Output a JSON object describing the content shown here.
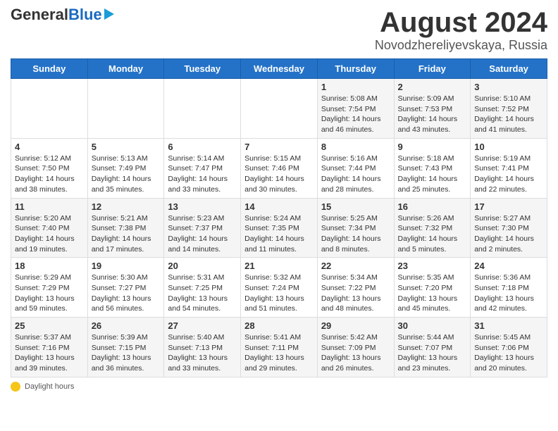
{
  "header": {
    "logo_general": "General",
    "logo_blue": "Blue",
    "month_title": "August 2024",
    "location": "Novodzhereliyevskaya, Russia"
  },
  "days_of_week": [
    "Sunday",
    "Monday",
    "Tuesday",
    "Wednesday",
    "Thursday",
    "Friday",
    "Saturday"
  ],
  "weeks": [
    [
      {
        "day": "",
        "info": ""
      },
      {
        "day": "",
        "info": ""
      },
      {
        "day": "",
        "info": ""
      },
      {
        "day": "",
        "info": ""
      },
      {
        "day": "1",
        "info": "Sunrise: 5:08 AM\nSunset: 7:54 PM\nDaylight: 14 hours and 46 minutes."
      },
      {
        "day": "2",
        "info": "Sunrise: 5:09 AM\nSunset: 7:53 PM\nDaylight: 14 hours and 43 minutes."
      },
      {
        "day": "3",
        "info": "Sunrise: 5:10 AM\nSunset: 7:52 PM\nDaylight: 14 hours and 41 minutes."
      }
    ],
    [
      {
        "day": "4",
        "info": "Sunrise: 5:12 AM\nSunset: 7:50 PM\nDaylight: 14 hours and 38 minutes."
      },
      {
        "day": "5",
        "info": "Sunrise: 5:13 AM\nSunset: 7:49 PM\nDaylight: 14 hours and 35 minutes."
      },
      {
        "day": "6",
        "info": "Sunrise: 5:14 AM\nSunset: 7:47 PM\nDaylight: 14 hours and 33 minutes."
      },
      {
        "day": "7",
        "info": "Sunrise: 5:15 AM\nSunset: 7:46 PM\nDaylight: 14 hours and 30 minutes."
      },
      {
        "day": "8",
        "info": "Sunrise: 5:16 AM\nSunset: 7:44 PM\nDaylight: 14 hours and 28 minutes."
      },
      {
        "day": "9",
        "info": "Sunrise: 5:18 AM\nSunset: 7:43 PM\nDaylight: 14 hours and 25 minutes."
      },
      {
        "day": "10",
        "info": "Sunrise: 5:19 AM\nSunset: 7:41 PM\nDaylight: 14 hours and 22 minutes."
      }
    ],
    [
      {
        "day": "11",
        "info": "Sunrise: 5:20 AM\nSunset: 7:40 PM\nDaylight: 14 hours and 19 minutes."
      },
      {
        "day": "12",
        "info": "Sunrise: 5:21 AM\nSunset: 7:38 PM\nDaylight: 14 hours and 17 minutes."
      },
      {
        "day": "13",
        "info": "Sunrise: 5:23 AM\nSunset: 7:37 PM\nDaylight: 14 hours and 14 minutes."
      },
      {
        "day": "14",
        "info": "Sunrise: 5:24 AM\nSunset: 7:35 PM\nDaylight: 14 hours and 11 minutes."
      },
      {
        "day": "15",
        "info": "Sunrise: 5:25 AM\nSunset: 7:34 PM\nDaylight: 14 hours and 8 minutes."
      },
      {
        "day": "16",
        "info": "Sunrise: 5:26 AM\nSunset: 7:32 PM\nDaylight: 14 hours and 5 minutes."
      },
      {
        "day": "17",
        "info": "Sunrise: 5:27 AM\nSunset: 7:30 PM\nDaylight: 14 hours and 2 minutes."
      }
    ],
    [
      {
        "day": "18",
        "info": "Sunrise: 5:29 AM\nSunset: 7:29 PM\nDaylight: 13 hours and 59 minutes."
      },
      {
        "day": "19",
        "info": "Sunrise: 5:30 AM\nSunset: 7:27 PM\nDaylight: 13 hours and 56 minutes."
      },
      {
        "day": "20",
        "info": "Sunrise: 5:31 AM\nSunset: 7:25 PM\nDaylight: 13 hours and 54 minutes."
      },
      {
        "day": "21",
        "info": "Sunrise: 5:32 AM\nSunset: 7:24 PM\nDaylight: 13 hours and 51 minutes."
      },
      {
        "day": "22",
        "info": "Sunrise: 5:34 AM\nSunset: 7:22 PM\nDaylight: 13 hours and 48 minutes."
      },
      {
        "day": "23",
        "info": "Sunrise: 5:35 AM\nSunset: 7:20 PM\nDaylight: 13 hours and 45 minutes."
      },
      {
        "day": "24",
        "info": "Sunrise: 5:36 AM\nSunset: 7:18 PM\nDaylight: 13 hours and 42 minutes."
      }
    ],
    [
      {
        "day": "25",
        "info": "Sunrise: 5:37 AM\nSunset: 7:16 PM\nDaylight: 13 hours and 39 minutes."
      },
      {
        "day": "26",
        "info": "Sunrise: 5:39 AM\nSunset: 7:15 PM\nDaylight: 13 hours and 36 minutes."
      },
      {
        "day": "27",
        "info": "Sunrise: 5:40 AM\nSunset: 7:13 PM\nDaylight: 13 hours and 33 minutes."
      },
      {
        "day": "28",
        "info": "Sunrise: 5:41 AM\nSunset: 7:11 PM\nDaylight: 13 hours and 29 minutes."
      },
      {
        "day": "29",
        "info": "Sunrise: 5:42 AM\nSunset: 7:09 PM\nDaylight: 13 hours and 26 minutes."
      },
      {
        "day": "30",
        "info": "Sunrise: 5:44 AM\nSunset: 7:07 PM\nDaylight: 13 hours and 23 minutes."
      },
      {
        "day": "31",
        "info": "Sunrise: 5:45 AM\nSunset: 7:06 PM\nDaylight: 13 hours and 20 minutes."
      }
    ]
  ],
  "footer": {
    "daylight_label": "Daylight hours"
  }
}
